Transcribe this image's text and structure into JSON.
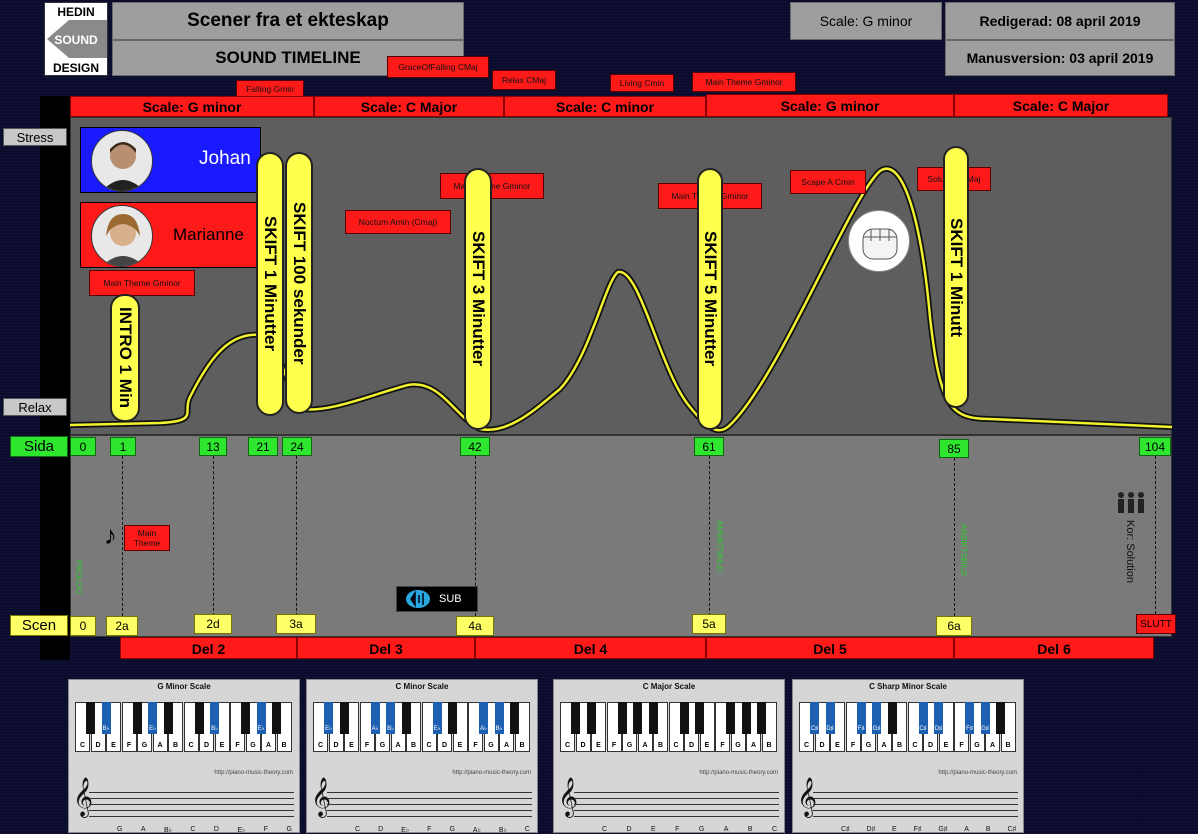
{
  "header": {
    "logo": {
      "line1": "HEDIN",
      "line2": "SOUND",
      "line3": "DESIGN"
    },
    "title": "Scener fra et ekteskap",
    "subtitle": "SOUND TIMELINE",
    "scale": "Scale: G minor",
    "edited": "Redigerad: 08 april 2019",
    "script_version": "Manusversion: 03 april 2019"
  },
  "axis": {
    "stress": "Stress",
    "relax": "Relax",
    "page": "Sida",
    "scene": "Scen"
  },
  "scale_bars": [
    "Scale: G minor",
    "Scale: C Major",
    "Scale: C minor",
    "Scale: G minor",
    "Scale: C Major"
  ],
  "music_tags": [
    "Falling Gmin",
    "GraceOfFalling CMaj",
    "Relax CMaj",
    "Living Cmin",
    "Main Theme Gminor"
  ],
  "characters": [
    {
      "name": "Johan",
      "color": "#1a1aff"
    },
    {
      "name": "Marianne",
      "color": "#ff1a1a"
    }
  ],
  "cues": [
    "Main Theme Gminor",
    "Noctum Amin (Cmaj)",
    "Main Theme Gminor",
    "Main Theme Gminor",
    "Scape A Cmin",
    "Solution CMaj"
  ],
  "shifts": [
    "INTRO 1 Min",
    "SKIFT 1 Minutter",
    "SKIFT 100 sekunder",
    "SKIFT 3 Minutter",
    "SKIFT 5 Minutter",
    "SKIFT 1 Minutt"
  ],
  "pages": [
    "0",
    "1",
    "13",
    "21",
    "24",
    "42",
    "61",
    "85",
    "104"
  ],
  "scenes": [
    "0",
    "2a",
    "2d",
    "3a",
    "4a",
    "5a",
    "6a",
    "SLUTT"
  ],
  "lower": {
    "main_theme": "Main Theme",
    "prolog": "PROLOG",
    "sub": "SUB",
    "ansiktsbild_1": "ANSIKTSBILD",
    "ansiktsbild_2": "ANSIKTSBILD",
    "kor": "Kor: Solution"
  },
  "acts": [
    "Del 2",
    "Del 3",
    "Del 4",
    "Del 5",
    "Del 6"
  ],
  "scale_cards": [
    {
      "title": "G Minor Scale",
      "white": [
        "C",
        "D",
        "E",
        "F",
        "G",
        "A",
        "B",
        "C",
        "D",
        "E",
        "F",
        "G",
        "A",
        "B"
      ],
      "black": [
        "",
        "B♭",
        "",
        "E♭",
        "",
        "",
        "B♭",
        "",
        "E♭",
        ""
      ],
      "notes": [
        "G",
        "A",
        "B♭",
        "C",
        "D",
        "E♭",
        "F",
        "G"
      ]
    },
    {
      "title": "C Minor Scale",
      "white": [
        "C",
        "D",
        "E",
        "F",
        "G",
        "A",
        "B",
        "C",
        "D",
        "E",
        "F",
        "G",
        "A",
        "B"
      ],
      "black": [
        "E♭",
        "",
        "A♭",
        "B♭",
        "",
        "E♭",
        "",
        "A♭",
        "B♭",
        ""
      ],
      "notes": [
        "C",
        "D",
        "E♭",
        "F",
        "G",
        "A♭",
        "B♭",
        "C"
      ]
    },
    {
      "title": "C Major Scale",
      "white": [
        "C",
        "D",
        "E",
        "F",
        "G",
        "A",
        "B",
        "C",
        "D",
        "E",
        "F",
        "G",
        "A",
        "B"
      ],
      "black": [
        "",
        "",
        "",
        "",
        "",
        "",
        "",
        "",
        "",
        ""
      ],
      "notes": [
        "C",
        "D",
        "E",
        "F",
        "G",
        "A",
        "B",
        "C"
      ]
    },
    {
      "title": "C Sharp Minor Scale",
      "white": [
        "C",
        "D",
        "E",
        "F",
        "G",
        "A",
        "B",
        "C",
        "D",
        "E",
        "F",
        "G",
        "A",
        "B"
      ],
      "black": [
        "C♯",
        "D♯",
        "F♯",
        "G♯",
        "",
        "C♯",
        "D♯",
        "F♯",
        "G♯",
        ""
      ],
      "notes": [
        "C♯",
        "D♯",
        "E",
        "F♯",
        "G♯",
        "A",
        "B",
        "C♯"
      ]
    }
  ],
  "footer_url": "http://piano-music-theory.com",
  "colors": {
    "accent_red": "#ff1a1a",
    "pill_yellow": "#ffff4d",
    "page_green": "#2ee62e",
    "curve": "#f2f230"
  }
}
